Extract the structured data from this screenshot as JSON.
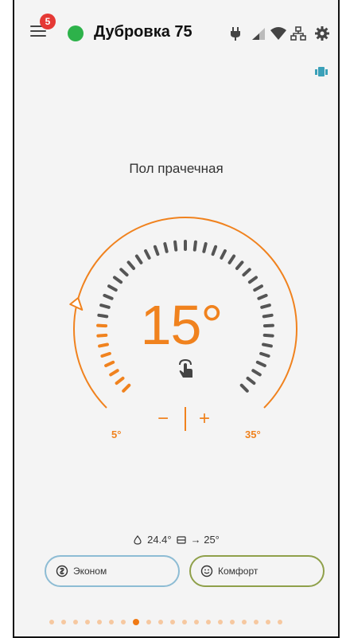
{
  "header": {
    "notification_count": "5",
    "device_name": "Дубровка 75",
    "status_color": "#2db24a",
    "icons": [
      "menu-icon",
      "power-plug-icon",
      "signal-icon",
      "wifi-icon",
      "network-icon",
      "settings-icon"
    ]
  },
  "zone": {
    "name": "Пол прачечная"
  },
  "thermostat": {
    "current_temp": "15°",
    "min_label": "5°",
    "max_label": "35°",
    "minus_label": "−",
    "plus_label": "+",
    "accent_color": "#f0821e"
  },
  "info": {
    "humidity_temp": "24.4°",
    "target": "→ 25°"
  },
  "modes": [
    {
      "label": "Эконом",
      "color": "#8dbcd4"
    },
    {
      "label": "Комфорт",
      "color": "#8fa04a"
    }
  ],
  "pager": {
    "total": 20,
    "active_index": 7
  }
}
